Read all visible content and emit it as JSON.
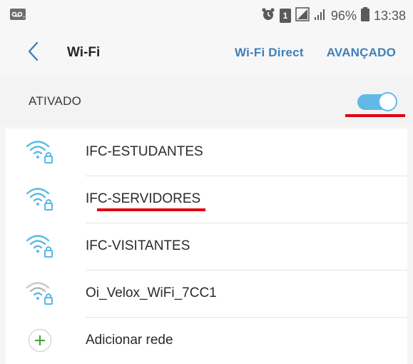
{
  "status_bar": {
    "battery_percent": "96%",
    "time": "13:38",
    "sim_badge": "1"
  },
  "app_bar": {
    "title": "Wi-Fi",
    "actions": [
      "Wi-Fi Direct",
      "AVANÇADO"
    ]
  },
  "master_switch": {
    "label": "ATIVADO",
    "on": true
  },
  "networks": [
    {
      "ssid": "IFC-ESTUDANTES",
      "secured": true,
      "signal": "strong"
    },
    {
      "ssid": "IFC-SERVIDORES",
      "secured": true,
      "signal": "strong"
    },
    {
      "ssid": "IFC-VISITANTES",
      "secured": true,
      "signal": "strong"
    },
    {
      "ssid": "Oi_Velox_WiFi_7CC1",
      "secured": true,
      "signal": "weak"
    }
  ],
  "add_network": {
    "label": "Adicionar rede"
  },
  "colors": {
    "accent": "#3f7fb8",
    "wifi_strong": "#5bb8e6",
    "wifi_weak": "#b5b5b5",
    "toggle_on": "#62b9e8",
    "add_icon": "#3ca43c",
    "highlight": "#e0000b"
  }
}
